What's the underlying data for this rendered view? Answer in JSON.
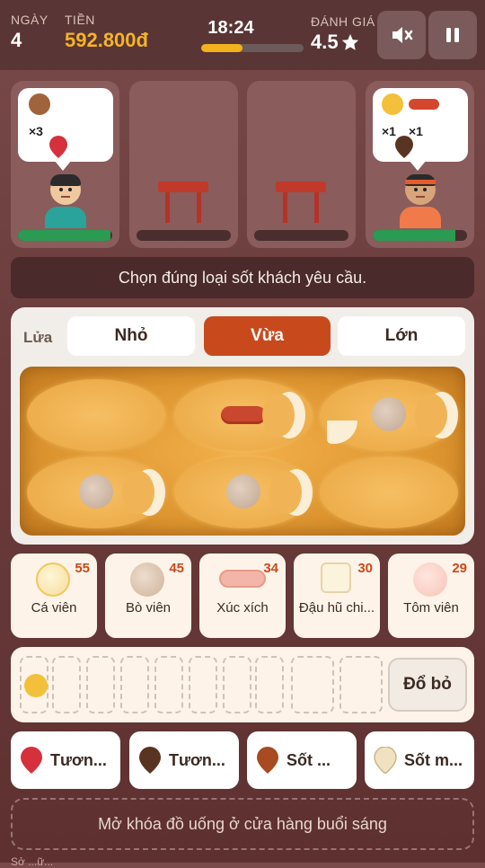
{
  "header": {
    "day_label": "NGÀY",
    "day_value": "4",
    "money_label": "TIỀN",
    "money_value": "592.800đ",
    "time_value": "18:24",
    "time_progress": 0.4,
    "rating_label": "ĐÁNH GIÁ",
    "rating_value": "4.5",
    "mute_icon": "speaker-muted-icon",
    "pause_icon": "pause-icon"
  },
  "customers": [
    {
      "order": [
        {
          "item": "beef-ball",
          "count": "×3",
          "sauce": "red"
        }
      ],
      "patience": 0.98
    },
    {
      "empty": true
    },
    {
      "empty": true
    },
    {
      "order": [
        {
          "item": "fish-ball",
          "count": "×1",
          "sauce": "brown"
        },
        {
          "item": "sausage",
          "count": "×1"
        }
      ],
      "patience": 0.88
    }
  ],
  "hint": "Chọn đúng loại sốt khách yêu cầu.",
  "heat": {
    "label": "Lửa",
    "options": [
      "Nhỏ",
      "Vừa",
      "Lớn"
    ],
    "selected": "Vừa"
  },
  "ingredients": [
    {
      "name": "Cá viên",
      "stock": "55",
      "color": "#f6e0a8"
    },
    {
      "name": "Bò viên",
      "stock": "45",
      "color": "#d9c2ae"
    },
    {
      "name": "Xúc xích",
      "stock": "34",
      "color": "#f2b5a8"
    },
    {
      "name": "Đậu hũ chi...",
      "stock": "30",
      "color": "#f7edd2"
    },
    {
      "name": "Tôm viên",
      "stock": "29",
      "color": "#f9cfc4"
    }
  ],
  "skewer": {
    "discard_label": "Đổ bỏ"
  },
  "sauces": [
    {
      "name": "Tươn...",
      "color": "#d6303d"
    },
    {
      "name": "Tươn...",
      "color": "#5a3422"
    },
    {
      "name": "Sốt ...",
      "color": "#a84a22"
    },
    {
      "name": "Sốt m...",
      "color": "#f0e2c0"
    }
  ],
  "unlock_text": "Mở khóa đồ uống ở cửa hàng buổi sáng",
  "footer_text": "Sở  ...ữ..."
}
